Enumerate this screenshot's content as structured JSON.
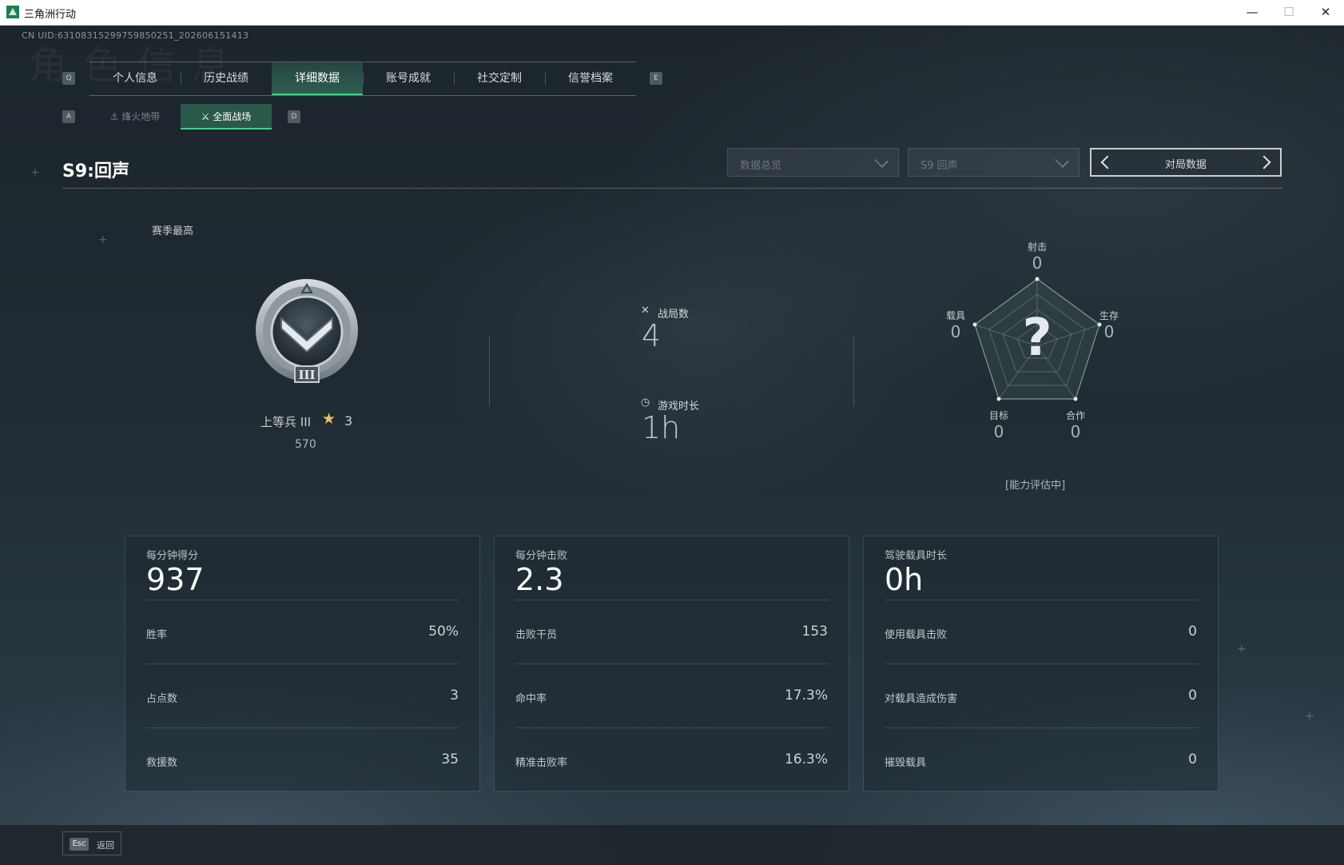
{
  "window": {
    "title": "三角洲行动",
    "controls": {
      "minimize": "—",
      "maximize": "☐",
      "close": "✕"
    }
  },
  "uid": "CN UID:6310831529975985025​1_202606151413",
  "watermark": "角色信息",
  "tabs": {
    "prev_key": "Q",
    "next_key": "E",
    "items": [
      {
        "label": "个人信息"
      },
      {
        "label": "历史战绩"
      },
      {
        "label": "详细数据",
        "active": true
      },
      {
        "label": "账号成就"
      },
      {
        "label": "社交定制"
      },
      {
        "label": "信誉档案"
      }
    ]
  },
  "subtabs": {
    "prev_key": "A",
    "next_key": "D",
    "items": [
      {
        "label": "烽火地带",
        "icon": "zone-icon"
      },
      {
        "label": "全面战场",
        "icon": "battlefield-icon",
        "active": true
      }
    ]
  },
  "season_title": "S9:回声",
  "filters": {
    "data_select": "数据总览",
    "season_select": "S9 回声",
    "pager_label": "对局数据"
  },
  "rank": {
    "section_label": "赛季最高",
    "name": "上等兵 III",
    "stars": "3",
    "score": "570",
    "badge_numeral": "III"
  },
  "summary": {
    "matches_label": "战局数",
    "matches_value": "4",
    "playtime_label": "游戏时长",
    "playtime_value": "1h"
  },
  "radar": {
    "center_symbol": "?",
    "axes": [
      {
        "label": "射击",
        "value": "0"
      },
      {
        "label": "生存",
        "value": "0"
      },
      {
        "label": "合作",
        "value": "0"
      },
      {
        "label": "目标",
        "value": "0"
      },
      {
        "label": "载具",
        "value": "0"
      }
    ],
    "status": "[能力评估中]"
  },
  "cards": [
    {
      "head_label": "每分钟得分",
      "head_value": "937",
      "rows": [
        {
          "label": "胜率",
          "value": "50%"
        },
        {
          "label": "占点数",
          "value": "3"
        },
        {
          "label": "救援数",
          "value": "35"
        }
      ]
    },
    {
      "head_label": "每分钟击败",
      "head_value": "2.3",
      "rows": [
        {
          "label": "击败干员",
          "value": "153"
        },
        {
          "label": "命中率",
          "value": "17.3%"
        },
        {
          "label": "精准击败率",
          "value": "16.3%"
        }
      ]
    },
    {
      "head_label": "驾驶载具时长",
      "head_value": "0h",
      "rows": [
        {
          "label": "使用载具击败",
          "value": "0"
        },
        {
          "label": "对载具造成伤害",
          "value": "0"
        },
        {
          "label": "摧毁载具",
          "value": "0"
        }
      ]
    }
  ],
  "footer": {
    "esc_key": "Esc",
    "back_label": "返回"
  },
  "colors": {
    "accent": "#3fd08c",
    "star": "#e8c15a",
    "background": "#1b252d"
  }
}
